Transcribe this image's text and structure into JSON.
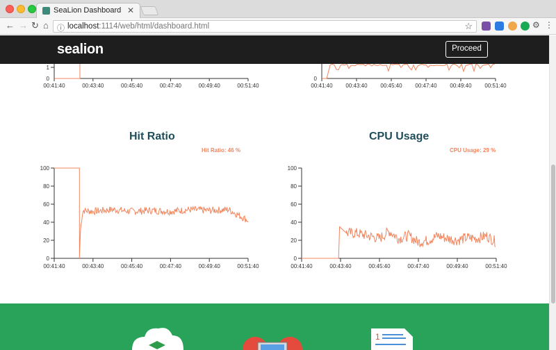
{
  "browser": {
    "tab_title": "SeaLion Dashboard",
    "url_host": "localhost",
    "url_rest": ":1114/web/html/dashboard.html"
  },
  "app": {
    "logo": "sealion",
    "proceed_label": "Proceed"
  },
  "top_charts": {
    "left": {
      "x_ticks": [
        "00:41:40",
        "00:43:40",
        "00:45:40",
        "00:47:40",
        "00:49:40",
        "00:51:40"
      ],
      "visible_y_ticks": [
        "1",
        "0"
      ]
    },
    "right": {
      "x_ticks": [
        "00:41:40",
        "00:43:40",
        "00:45:40",
        "00:47:40",
        "00:49:40",
        "00:51:40"
      ],
      "visible_y_ticks": [
        "0"
      ]
    }
  },
  "panels": {
    "hit_ratio": {
      "title": "Hit Ratio",
      "readout": "Hit Ratio: 46 %"
    },
    "cpu_usage": {
      "title": "CPU Usage",
      "readout": "CPU Usage: 29 %"
    }
  },
  "chart_data": [
    {
      "type": "line",
      "title": "Hit Ratio",
      "x_ticks": [
        "00:41:40",
        "00:43:40",
        "00:45:40",
        "00:47:40",
        "00:49:40",
        "00:51:40"
      ],
      "y_ticks": [
        "0",
        "20",
        "40",
        "60",
        "80",
        "100"
      ],
      "ylim": [
        0,
        100
      ],
      "series": [
        {
          "color": "#f2845c",
          "x_minutes": [
            0,
            1.3,
            1.3,
            1.35,
            1.45,
            1.5,
            2,
            3,
            4,
            5,
            6,
            7,
            8,
            9,
            10
          ],
          "values": [
            100,
            100,
            0,
            30,
            50,
            53,
            52,
            54,
            52,
            53,
            52,
            54,
            53,
            54,
            42
          ]
        }
      ]
    },
    {
      "type": "line",
      "title": "CPU Usage",
      "x_ticks": [
        "00:41:40",
        "00:43:40",
        "00:45:40",
        "00:47:40",
        "00:49:40",
        "00:51:40"
      ],
      "y_ticks": [
        "0",
        "20",
        "40",
        "60",
        "80",
        "100"
      ],
      "ylim": [
        0,
        100
      ],
      "series": [
        {
          "color": "#f2845c",
          "x_minutes": [
            0,
            1.9,
            1.95,
            2.3,
            2.8,
            3.4,
            4,
            4.5,
            5,
            5.5,
            6,
            6.5,
            7,
            7.5,
            8,
            8.5,
            9,
            9.5,
            10
          ],
          "values": [
            0,
            0,
            35,
            28,
            28,
            25,
            22,
            30,
            22,
            25,
            18,
            20,
            25,
            22,
            20,
            23,
            22,
            25,
            18
          ]
        }
      ]
    }
  ]
}
